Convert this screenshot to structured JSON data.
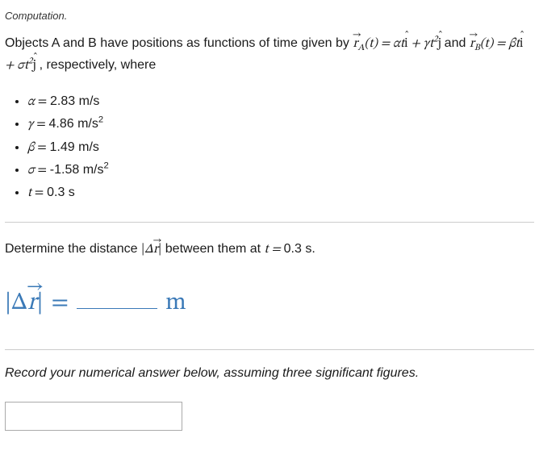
{
  "section_label": "Computation.",
  "intro_prefix": "Objects A and B have positions as functions of time given by ",
  "intro_middle": " and ",
  "intro_suffix": ", respectively, where",
  "eqA_sub": "A",
  "eqA_arg": "(t) = αt",
  "eqA_plus": " + γt",
  "eqB_sub": "B",
  "eqB_arg": "(t) = βt",
  "eqB_plus": " + σt",
  "sq": "2",
  "params": [
    {
      "sym": "α",
      "eq": " = ",
      "val": "2.83 m/s"
    },
    {
      "sym": "γ",
      "eq": " = ",
      "val": "4.86 m/s",
      "sup": "2"
    },
    {
      "sym": "β",
      "eq": " = ",
      "val": "1.49 m/s"
    },
    {
      "sym": "σ",
      "eq": " = ",
      "val": "-1.58 m/s",
      "sup": "2"
    },
    {
      "sym": "t",
      "eq": " = ",
      "val": "0.3 s"
    }
  ],
  "determine_prefix": "Determine the distance ",
  "determine_middle": " between them at ",
  "determine_t": "t = ",
  "determine_val": "0.3 s.",
  "answer_eq": " = ",
  "answer_unit": "m",
  "instruct": "Record your numerical answer below, assuming three significant figures.",
  "answer_value": ""
}
